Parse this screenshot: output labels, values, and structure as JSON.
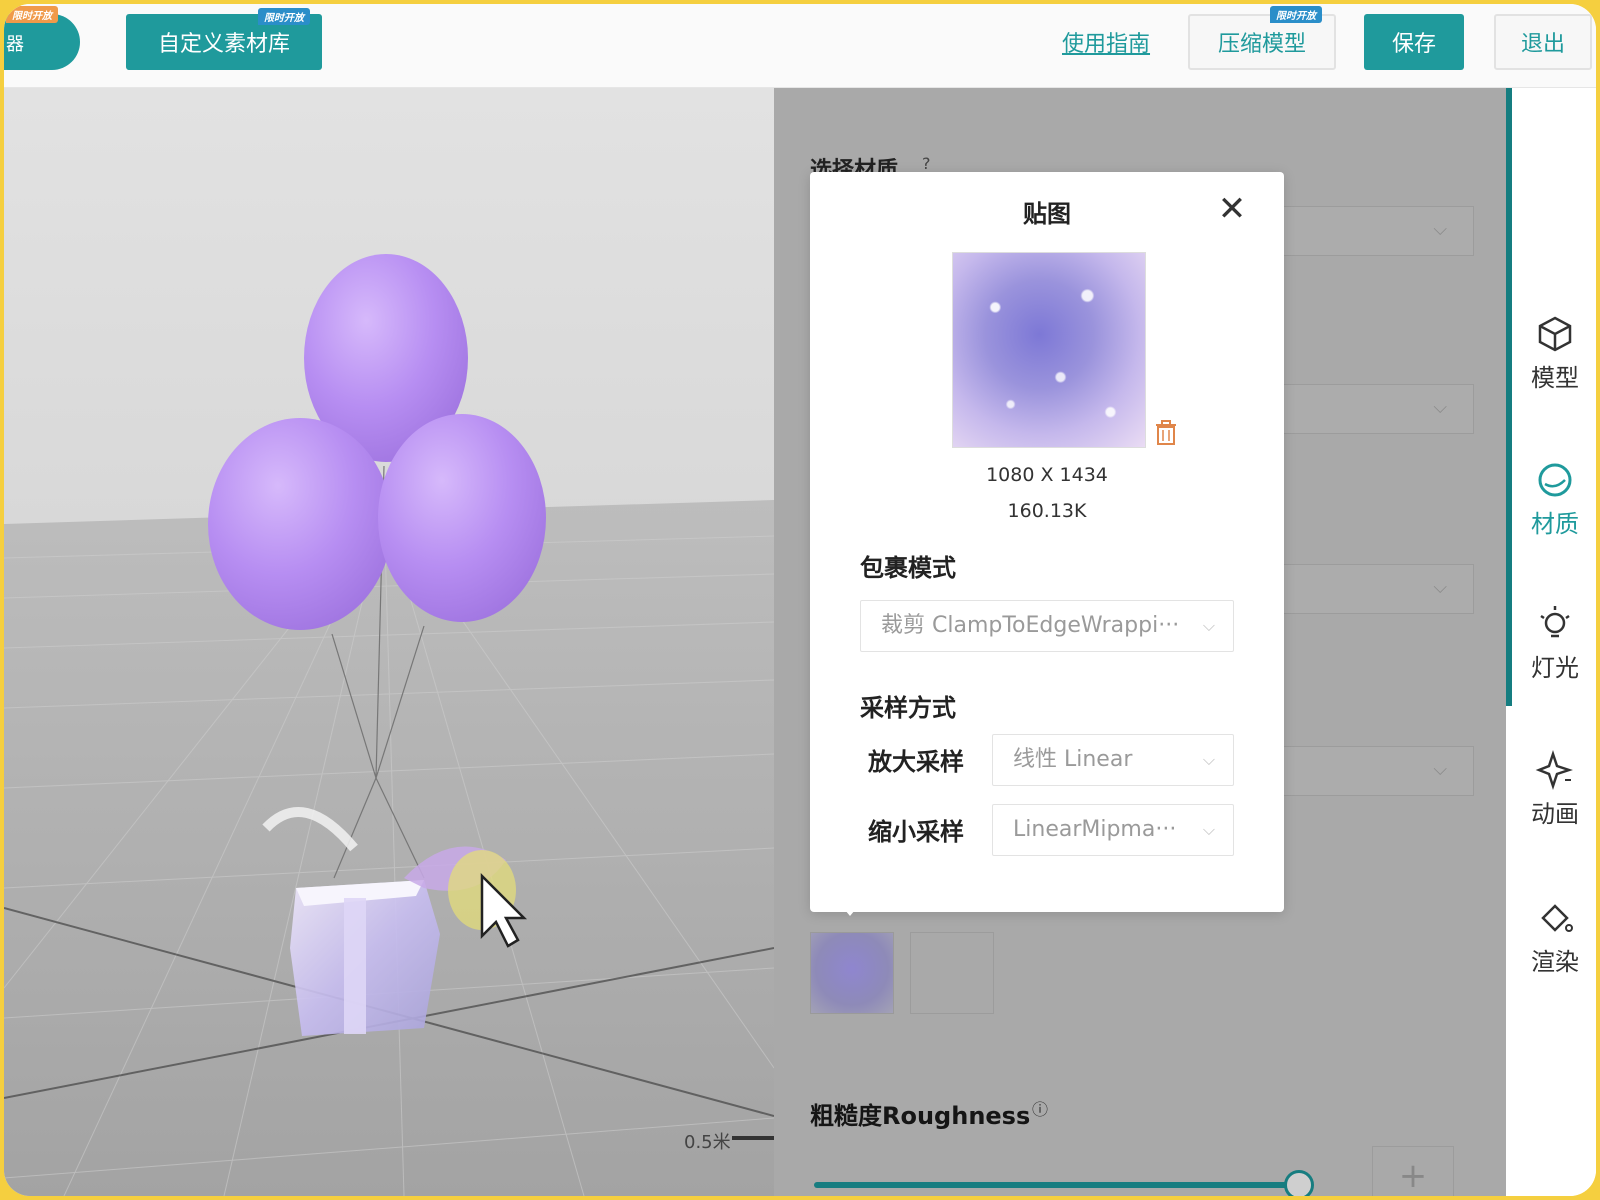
{
  "topbar": {
    "left_pill_text": "器",
    "left_pill_tag": "限时开放",
    "custom_library_button": "自定义素材库",
    "custom_library_tag": "限时开放",
    "guide_link": "使用指南",
    "compress_button": "压缩模型",
    "compress_tag": "限时开放",
    "save_button": "保存",
    "exit_button": "退出"
  },
  "viewport": {
    "scale_label": "0.5米"
  },
  "property_panel": {
    "material_title": "选择材质",
    "roughness_label": "粗糙度Roughness",
    "roughness_level": 0.97,
    "plus_symbol": "+"
  },
  "sidebar": {
    "items": [
      {
        "label": "模型",
        "icon": "cube-icon",
        "active": false
      },
      {
        "label": "材质",
        "icon": "material-icon",
        "active": true
      },
      {
        "label": "灯光",
        "icon": "bulb-icon",
        "active": false
      },
      {
        "label": "动画",
        "icon": "sparkle-icon",
        "active": false
      },
      {
        "label": "渲染",
        "icon": "paint-bucket-icon",
        "active": false
      }
    ]
  },
  "texture_modal": {
    "title": "贴图",
    "close_symbol": "✕",
    "dimensions": "1080 X 1434",
    "file_size": "160.13K",
    "wrap_mode_label": "包裹模式",
    "wrap_mode_value": "裁剪 ClampToEdgeWrappi···",
    "sampling_label": "采样方式",
    "mag_filter_label": "放大采样",
    "mag_filter_value": "线性 Linear",
    "min_filter_label": "缩小采样",
    "min_filter_value": "LinearMipma···"
  },
  "colors": {
    "accent": "#1f9a9c",
    "balloon": "#b88ef0",
    "frame": "#f5cf3f"
  }
}
